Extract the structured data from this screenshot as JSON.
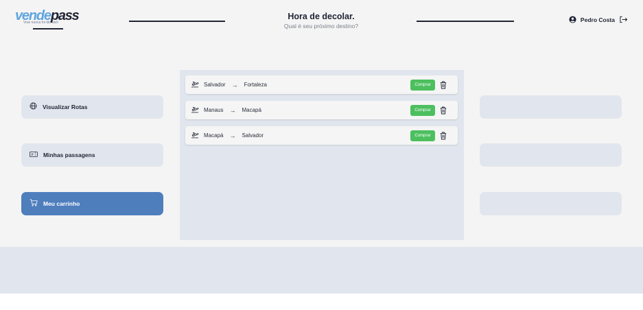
{
  "header": {
    "logo": {
      "part1": "vende",
      "part2": "pass",
      "slogan": "Voar nunca foi tão fácil"
    },
    "title": "Hora de decolar.",
    "subtitle": "Qual é seu próximo destino?",
    "user_name": "Pedro Costa"
  },
  "menu": [
    {
      "label": "Visualizar Rotas",
      "icon": "globe-icon",
      "active": false
    },
    {
      "label": "Minhas passagens",
      "icon": "ticket-icon",
      "active": false
    },
    {
      "label": "Meu carrinho",
      "icon": "cart-icon",
      "active": true
    }
  ],
  "routes": [
    {
      "from": "Salvador",
      "to": "Fortaleza",
      "buy_label": "Comprar"
    },
    {
      "from": "Manaus",
      "to": "Macapá",
      "buy_label": "Comprar"
    },
    {
      "from": "Macapá",
      "to": "Salvador",
      "buy_label": "Comprar"
    }
  ],
  "arrow": "→",
  "colors": {
    "accent": "#4f7ebd",
    "buy_button": "#4cbf5e",
    "logo_blue": "#5fa5df",
    "panel_bg": "#e1e6ee",
    "text_dark": "#1f2333"
  }
}
